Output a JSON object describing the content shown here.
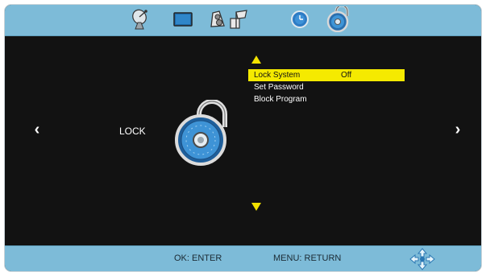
{
  "header": {
    "tabs": [
      {
        "name": "satellite-dish-icon"
      },
      {
        "name": "screen-icon"
      },
      {
        "name": "audio-icon"
      },
      {
        "name": "settings-flag-icon"
      },
      {
        "name": "clock-icon"
      },
      {
        "name": "lock-icon",
        "active": true
      }
    ]
  },
  "main": {
    "section_label": "LOCK",
    "left_arrow": "‹",
    "right_arrow": "›",
    "menu": [
      {
        "label": "Lock System",
        "value": "Off",
        "selected": true
      },
      {
        "label": "Set Password",
        "value": ""
      },
      {
        "label": "Block Program",
        "value": ""
      }
    ]
  },
  "footer": {
    "ok_hint": "OK: ENTER",
    "menu_hint": "MENU: RETURN",
    "nav_icon": "directional-pad-icon"
  },
  "colors": {
    "bar": "#7dbbd8",
    "background": "#121212",
    "highlight": "#f5ea00",
    "arrow": "#f2e200"
  }
}
